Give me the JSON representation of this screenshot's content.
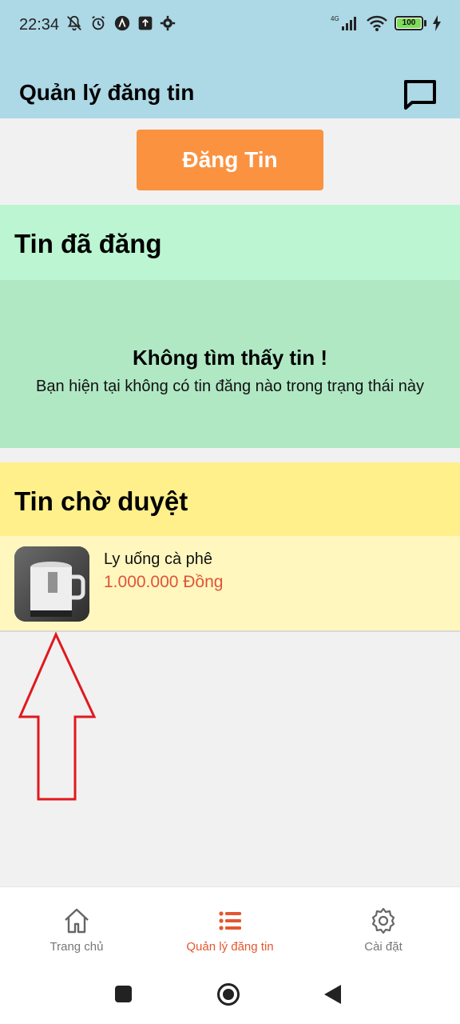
{
  "status_bar": {
    "time": "22:34",
    "battery": "100",
    "network": "4G"
  },
  "header": {
    "title": "Quản lý đăng tin"
  },
  "post_button": {
    "label": "Đăng Tin"
  },
  "posted_section": {
    "title": "Tin đã đăng",
    "empty_title": "Không tìm thấy tin !",
    "empty_subtitle": "Bạn hiện tại không có tin đăng nào trong trạng thái này"
  },
  "pending_section": {
    "title": "Tin chờ duyệt",
    "items": [
      {
        "name": "Ly uống cà phê",
        "price": "1.000.000 Đồng"
      }
    ]
  },
  "bottom_nav": {
    "items": [
      {
        "label": "Trang chủ",
        "icon": "home-icon"
      },
      {
        "label": "Quản lý đăng tin",
        "icon": "list-icon",
        "active": true
      },
      {
        "label": "Cài đặt",
        "icon": "gear-icon"
      }
    ]
  },
  "colors": {
    "header_bg": "#add8e6",
    "accent": "#fa9240",
    "posted_head_bg": "#bbf5d1",
    "posted_body_bg": "#b0e8c4",
    "pending_head_bg": "#fff08c",
    "pending_item_bg": "#fff7be",
    "price": "#e0533c",
    "nav_active": "#e4572e",
    "annotation_arrow": "#e0191e"
  }
}
